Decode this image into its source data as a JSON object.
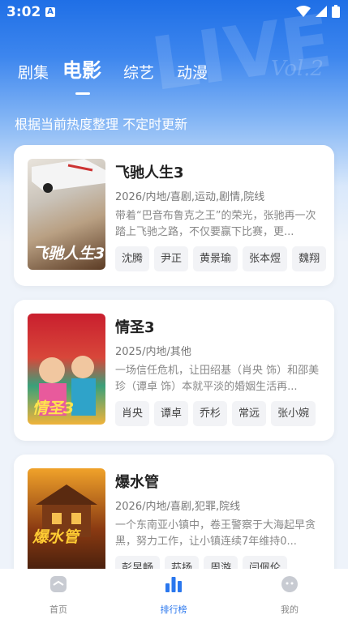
{
  "status": {
    "time": "3:02",
    "app_indicator": "A"
  },
  "tabs": [
    {
      "label": "剧集",
      "active": false
    },
    {
      "label": "电影",
      "active": true
    },
    {
      "label": "综艺",
      "active": false
    },
    {
      "label": "动漫",
      "active": false
    }
  ],
  "subtitle": "根据当前热度整理 不定时更新",
  "movies": [
    {
      "title": "飞驰人生3",
      "meta": "2026/内地/喜剧,运动,剧情,院线",
      "desc": "带着“巴音布鲁克之王”的荣光，张驰再一次踏上飞驰之路，不仅要赢下比赛，更...",
      "cast": [
        "沈腾",
        "尹正",
        "黄景瑜",
        "张本煜",
        "魏翔"
      ],
      "poster_text": "飞驰人生3"
    },
    {
      "title": "情圣3",
      "meta": "2025/内地/其他",
      "desc": "一场信任危机，让田绍基（肖央 饰）和邵美珍（谭卓 饰）本就平淡的婚姻生活再...",
      "cast": [
        "肖央",
        "谭卓",
        "乔杉",
        "常远",
        "张小婉"
      ],
      "poster_text": "情圣3"
    },
    {
      "title": "爆水管",
      "meta": "2026/内地/喜剧,犯罪,院线",
      "desc": "一个东南亚小镇中，卷王警察于大海起早贪黑，努力工作，让小镇连续7年维持0...",
      "cast": [
        "彭昱畅",
        "荪扬",
        "周游",
        "闫佩伦"
      ],
      "poster_text": "爆水管"
    }
  ],
  "nav": [
    {
      "label": "首页",
      "icon": "home-icon",
      "active": false
    },
    {
      "label": "排行榜",
      "icon": "ranking-icon",
      "active": true
    },
    {
      "label": "我的",
      "icon": "profile-icon",
      "active": false
    }
  ],
  "colors": {
    "accent": "#2a77ee",
    "header_blue": "#1f6fe6"
  }
}
